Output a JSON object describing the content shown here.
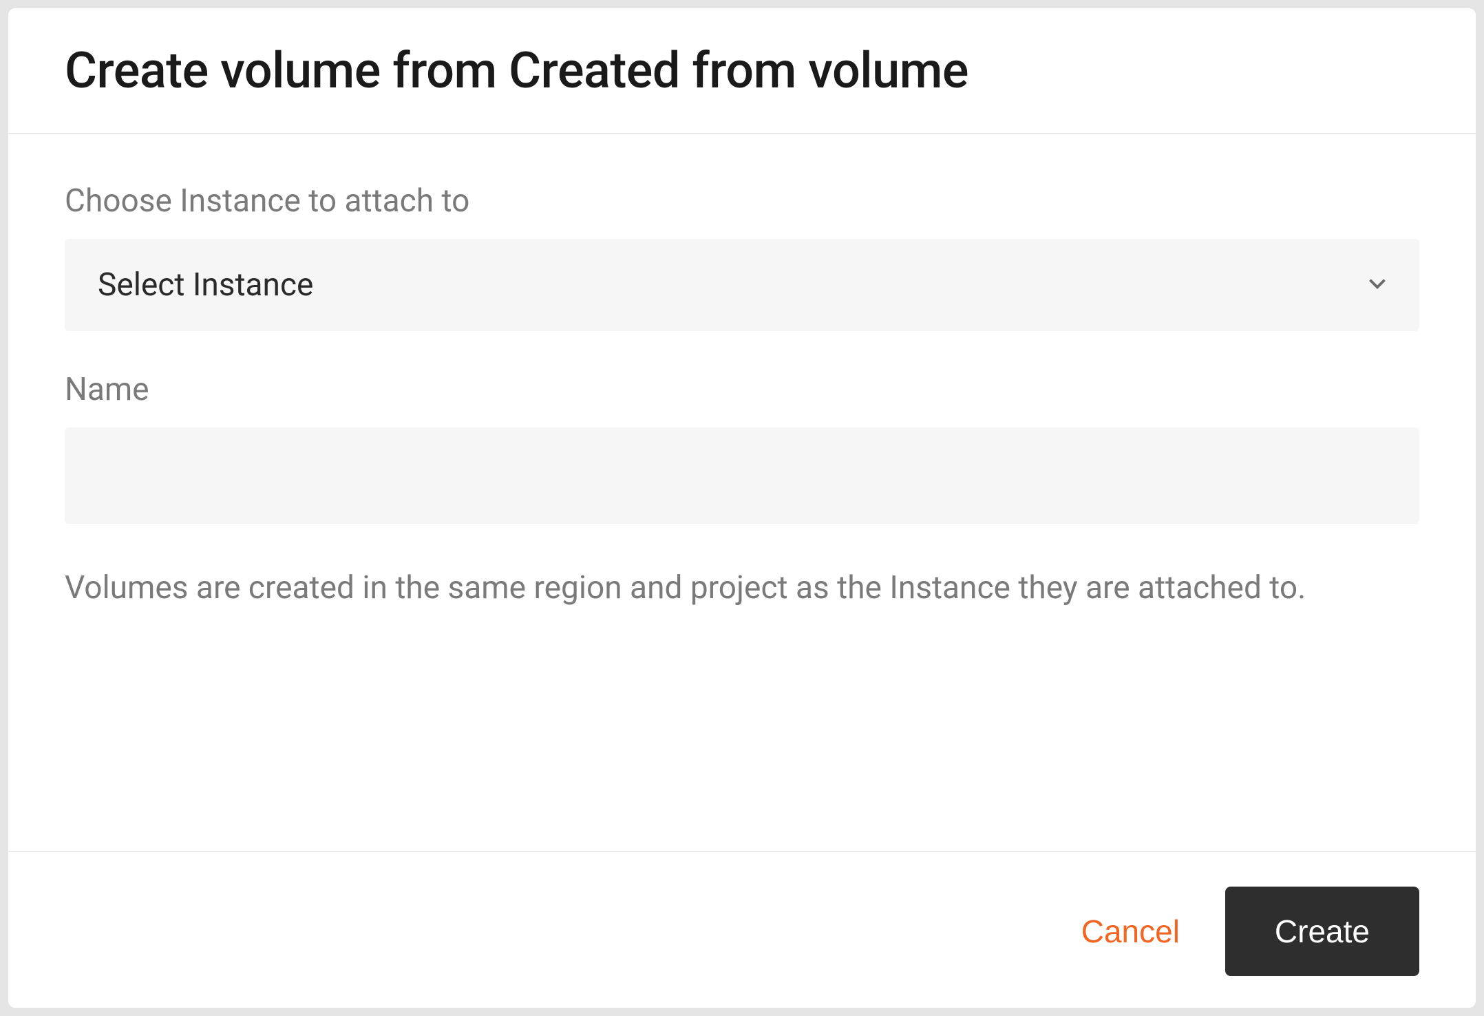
{
  "dialog": {
    "title": "Create volume from Created from volume",
    "fields": {
      "instance": {
        "label": "Choose Instance to attach to",
        "placeholder": "Select Instance",
        "value": "Select Instance"
      },
      "name": {
        "label": "Name",
        "value": ""
      }
    },
    "help_text": "Volumes are created in the same region and project as the Instance they are attached to.",
    "footer": {
      "cancel_label": "Cancel",
      "create_label": "Create"
    }
  }
}
